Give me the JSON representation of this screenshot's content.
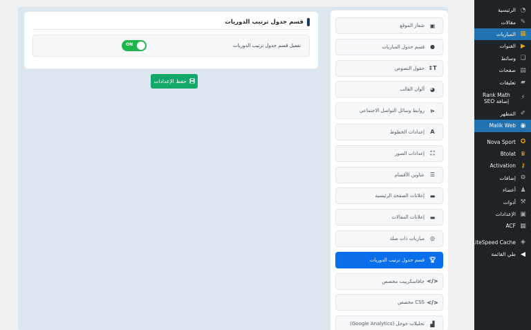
{
  "admin_menu": {
    "items": [
      {
        "label": "الرئيسية",
        "icon": "dashboard-icon"
      },
      {
        "label": "مقالات",
        "icon": "pushpin-icon"
      },
      {
        "label": "المباريات",
        "icon": "matches-icon"
      },
      {
        "label": "القنوات",
        "icon": "channels-icon"
      },
      {
        "label": "وسائط",
        "icon": "media-icon"
      },
      {
        "label": "صفحات",
        "icon": "pages-icon"
      },
      {
        "label": "تعليقات",
        "icon": "comments-icon"
      },
      {
        "label": "Rank Math إضافة SEO",
        "icon": "rankmath-icon"
      },
      {
        "label": "المظهر",
        "icon": "appearance-icon"
      },
      {
        "label": "Malik Web",
        "icon": "malikweb-icon"
      },
      {
        "label": "Nova Sport",
        "icon": "novasport-icon"
      },
      {
        "label": "Btolat",
        "icon": "trophy-icon"
      },
      {
        "label": "Activation",
        "icon": "key-icon"
      },
      {
        "label": "إضافات",
        "icon": "plugins-icon"
      },
      {
        "label": "أعضاء",
        "icon": "users-icon"
      },
      {
        "label": "أدوات",
        "icon": "tools-icon"
      },
      {
        "label": "الإعدادات",
        "icon": "settings-icon"
      },
      {
        "label": "ACF",
        "icon": "acf-icon"
      },
      {
        "label": "LiteSpeed Cache",
        "icon": "litespeed-icon"
      },
      {
        "label": "طي القائمة",
        "icon": "collapse-icon"
      }
    ]
  },
  "settings_nav": {
    "items": [
      {
        "label": "شعار الموقع",
        "icon": "image-icon"
      },
      {
        "label": "قسم جدول المباريات",
        "icon": "clock-icon"
      },
      {
        "label": "حقول النصوص",
        "icon": "text-fields-icon"
      },
      {
        "label": "ألوان القالب",
        "icon": "palette-icon"
      },
      {
        "label": "روابط وسائل التواصل الاجتماعي",
        "icon": "share-icon"
      },
      {
        "label": "إعدادات الخطوط",
        "icon": "font-icon"
      },
      {
        "label": "إعدادات الصور",
        "icon": "image-settings-icon"
      },
      {
        "label": "عناوين الأقسام",
        "icon": "list-icon"
      },
      {
        "label": "إعلانات الصفحة الرئيسية",
        "icon": "ad-icon"
      },
      {
        "label": "إعلانات المقالات",
        "icon": "ad-icon"
      },
      {
        "label": "مباريات ذات صلة",
        "icon": "target-icon"
      },
      {
        "label": "قسم جدول ترتيب الدوريات",
        "icon": "trophy-icon"
      },
      {
        "label": "جافاسكريبت مخصص",
        "icon": "code-icon"
      },
      {
        "label": "CSS مخصص",
        "icon": "code-icon"
      },
      {
        "label": "تحليلات جوجل (Google Analytics)",
        "icon": "analytics-icon"
      }
    ]
  },
  "section": {
    "title": "قسم جدول ترتيب الدوريات",
    "toggle_label": "تفعيل قسم جدول ترتيب الدوريات",
    "toggle_text": "ON"
  },
  "save_button": {
    "label": "حفظ الإعدادات"
  },
  "colors": {
    "admin_bg": "#1d2327",
    "admin_active": "#2271b1",
    "nav_active": "#0a6dea",
    "toggle_on": "#1eb54d",
    "save": "#12a86a"
  }
}
